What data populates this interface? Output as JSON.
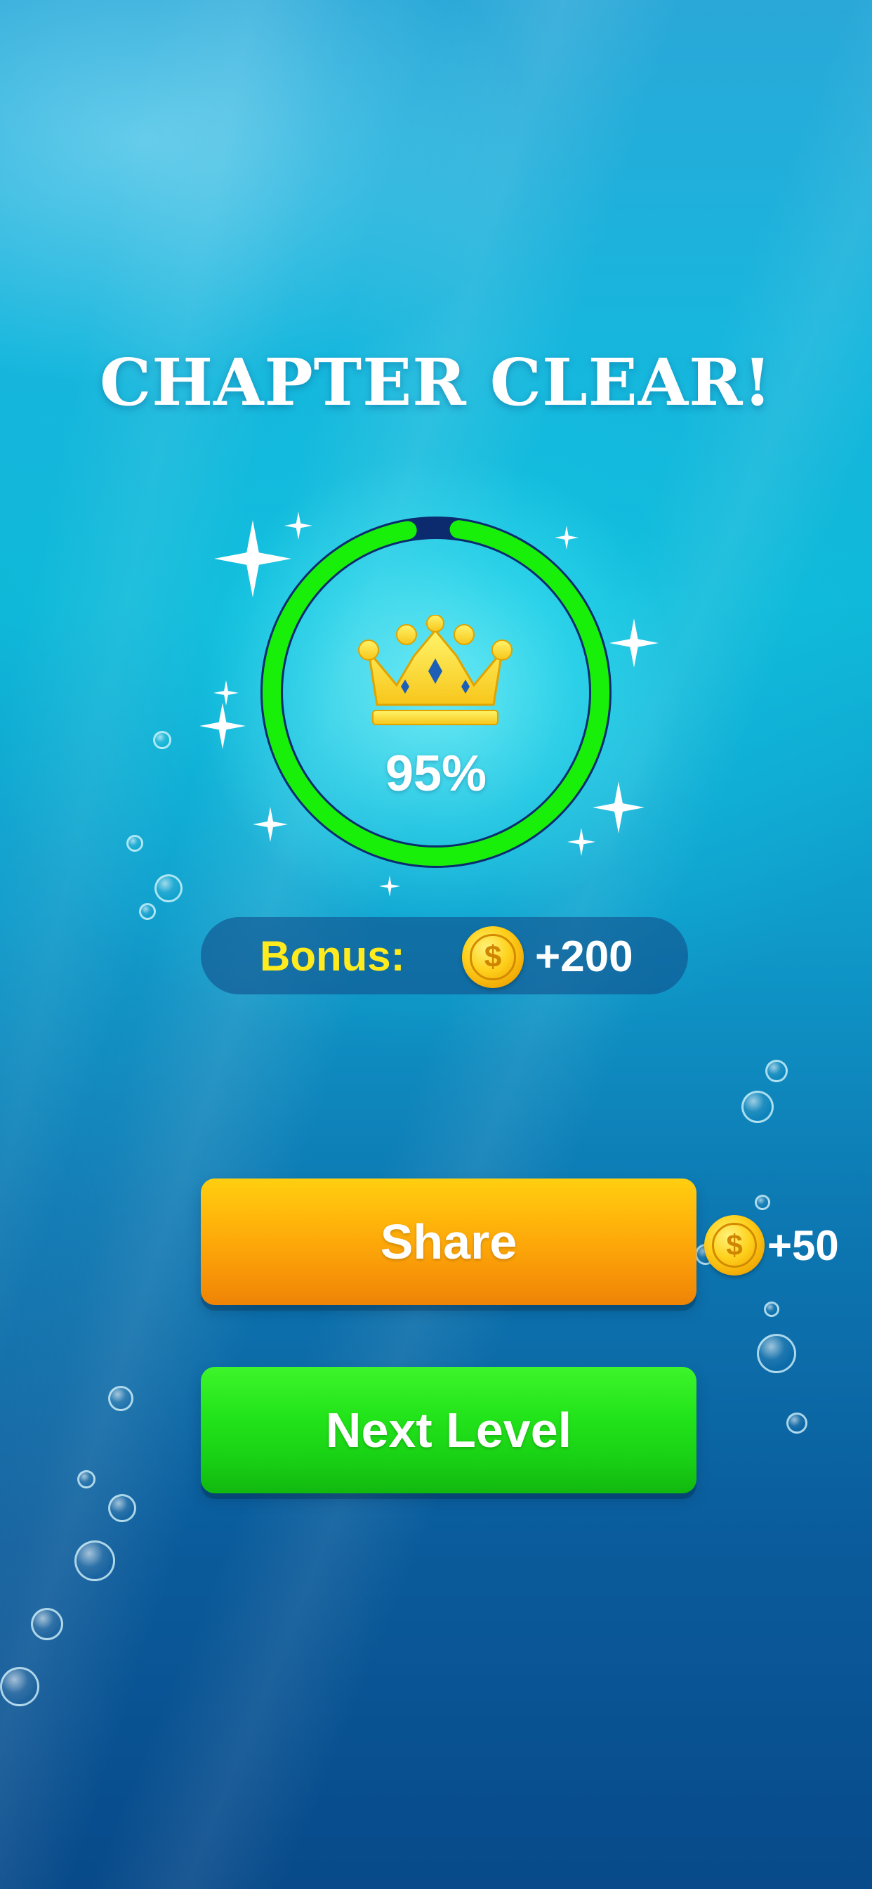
{
  "screen": {
    "title": "CHAPTER CLEAR!",
    "progress": {
      "percent_label": "95%",
      "fraction": 0.95,
      "fill_color": "#19f00a",
      "track_color": "#0b2b6e"
    },
    "crown_icon": "crown-icon",
    "bonus": {
      "label": "Bonus:",
      "coin_icon": "coin-icon",
      "value": "+200"
    },
    "share_button": {
      "label": "Share",
      "reward_icon": "coin-icon",
      "reward": "+50",
      "color": "#f99a08"
    },
    "next_button": {
      "label": "Next Level",
      "color": "#22e41a"
    }
  }
}
